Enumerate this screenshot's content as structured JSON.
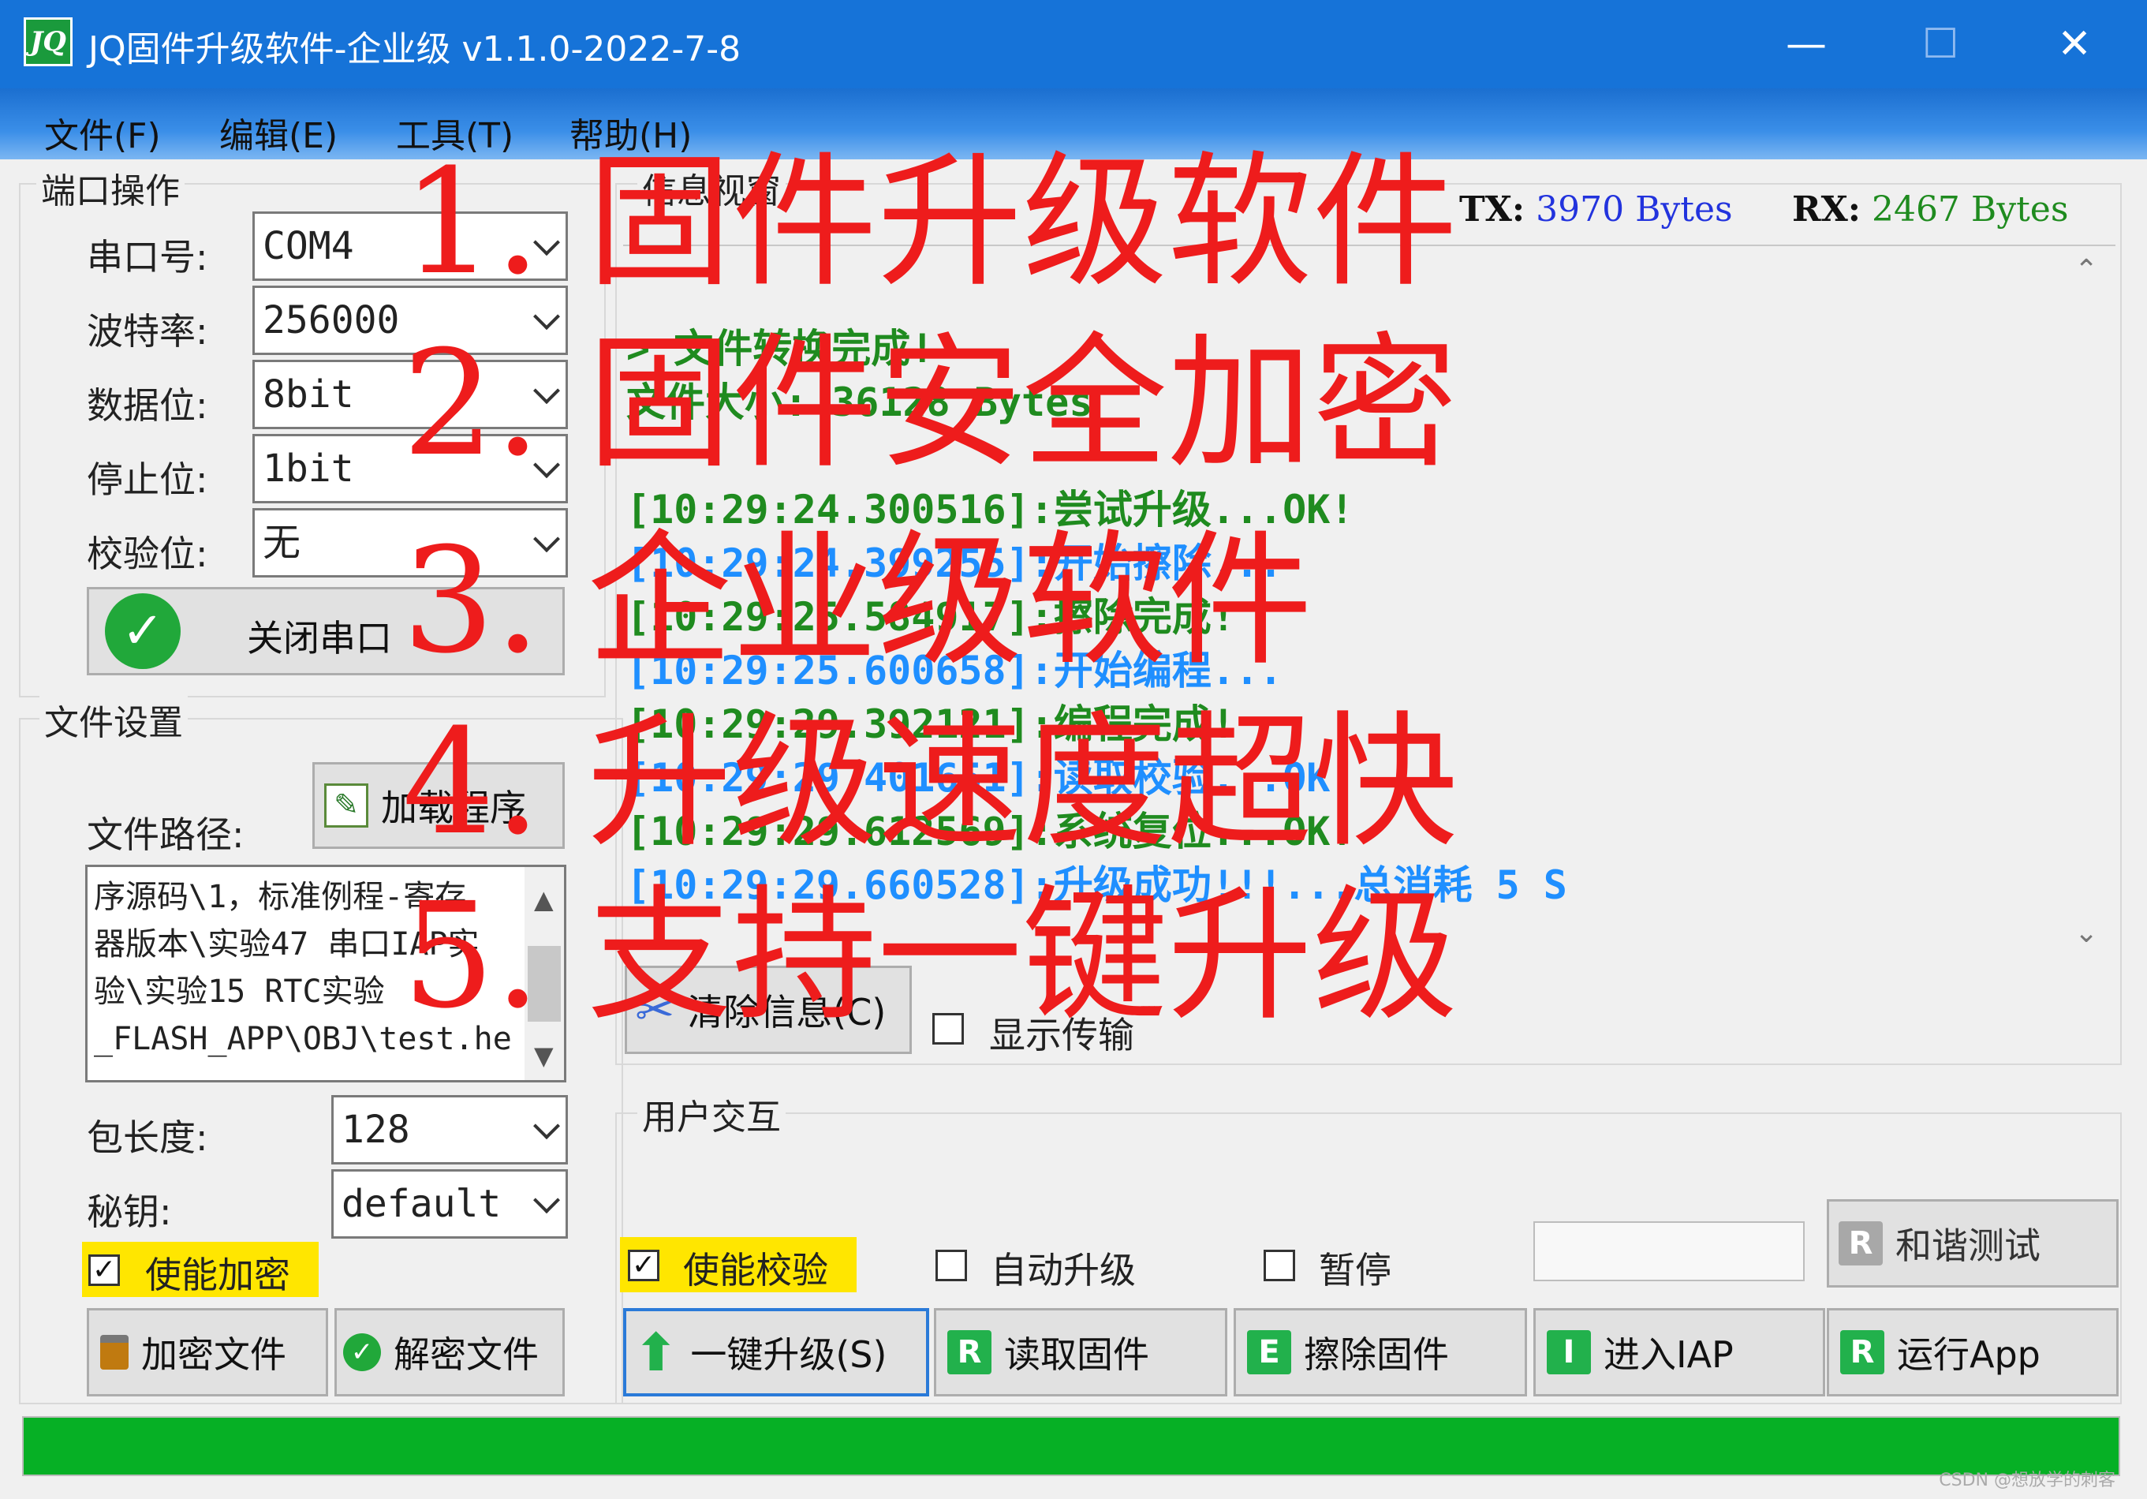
{
  "window": {
    "logo": "JQ",
    "title": "JQ固件升级软件-企业级 v1.1.0-2022-7-8",
    "minimize": "—",
    "maximize": "☐",
    "close": "✕"
  },
  "menu": [
    "文件(F)",
    "编辑(E)",
    "工具(T)",
    "帮助(H)"
  ],
  "port": {
    "group_title": "端口操作",
    "com_label": "串口号:",
    "com_value": "COM4",
    "baud_label": "波特率:",
    "baud_value": "256000",
    "data_label": "数据位:",
    "data_value": "8bit",
    "stop_label": "停止位:",
    "stop_value": "1bit",
    "parity_label": "校验位:",
    "parity_value": "无",
    "close_button": "关闭串口"
  },
  "file": {
    "group_title": "文件设置",
    "path_label": "文件路径:",
    "load_button": "加载程序",
    "path_lines": [
      "序源码\\1，标准例程-寄存",
      "器版本\\实验47 串口IAP实",
      "验\\实验15 RTC实验",
      "_FLASH_APP\\OBJ\\test.hex"
    ],
    "packet_label": "包长度:",
    "packet_value": "128",
    "key_label": "秘钥:",
    "key_value": "default",
    "encrypt_check": "使能加密",
    "encrypt_button": "加密文件",
    "decrypt_button": "解密文件"
  },
  "info": {
    "group_title": "信息视窗",
    "tx_label": "TX:",
    "tx_value": "3970 Bytes",
    "rx_label": "RX:",
    "rx_value": "2467 Bytes",
    "log": [
      {
        "text": "> 文件转换完成!",
        "color": "#1f8b1f"
      },
      {
        "text": "文件大小: 36128 Bytes",
        "color": "#1f8b1f"
      },
      {
        "text": "",
        "color": "#1f8b1f"
      },
      {
        "text": "[10:29:24.300516]:尝试升级...OK!",
        "color": "#1f8b1f"
      },
      {
        "text": "[10:29:24.399255]:开始擦除...",
        "color": "#1f8fff"
      },
      {
        "text": "[10:29:25.584917]:擦除完成!",
        "color": "#1f8b1f"
      },
      {
        "text": "[10:29:25.600658]:开始编程...",
        "color": "#1f8fff"
      },
      {
        "text": "[10:29:29.392121]:编程完成!",
        "color": "#1f8b1f"
      },
      {
        "text": "[10:29:29.401651]:读取校验...OK!",
        "color": "#1f8fff"
      },
      {
        "text": "[10:29:29.612569]:系统复位...OK!",
        "color": "#1f8b1f"
      },
      {
        "text": "[10:29:29.660528]:升级成功!!!...总消耗 5 S",
        "color": "#1f8fff"
      }
    ],
    "clear_button": "清除信息(C)",
    "show_transfer": "显示传输"
  },
  "user": {
    "group_title": "用户交互",
    "verify_check": "使能校验",
    "auto_upgrade": "自动升级",
    "pause": "暂停",
    "harmony_button": "和谐测试",
    "upgrade_button": "一键升级(S)",
    "read_button": "读取固件",
    "erase_button": "擦除固件",
    "iap_button": "进入IAP",
    "run_button": "运行App"
  },
  "overlay": [
    "1. 固件升级软件",
    "2. 固件安全加密",
    "3. 企业级软件",
    "4. 升级速度超快",
    "5. 支持一键升级"
  ],
  "watermark": "CSDN @想放学的刺客",
  "colors": {
    "titlebar": "#1673d8",
    "progress": "#06b025",
    "overlay_text": "#ee1c1c",
    "log_green": "#1f8b1f",
    "log_blue": "#1f8fff"
  }
}
